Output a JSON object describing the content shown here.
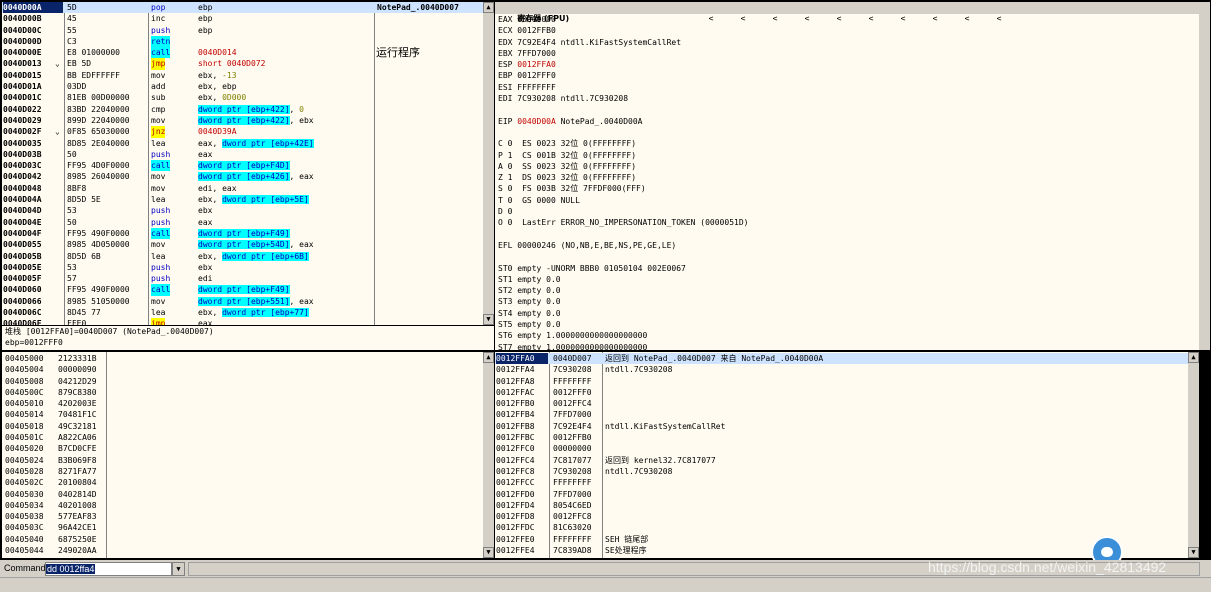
{
  "disasm": {
    "comment_label": "运行程序",
    "header_comment": "NotePad_.0040D007",
    "rows": [
      {
        "addr": "0040D00A",
        "mark": "",
        "hex": "5D",
        "mnem": "pop",
        "ops": "ebp",
        "sel": true,
        "mc": "blue"
      },
      {
        "addr": "0040D00B",
        "mark": "",
        "hex": "45",
        "mnem": "inc",
        "ops": "ebp"
      },
      {
        "addr": "0040D00C",
        "mark": "",
        "hex": "55",
        "mnem": "push",
        "ops": "ebp",
        "mc": "blue"
      },
      {
        "addr": "0040D00D",
        "mark": "",
        "hex": "C3",
        "mnem": "retn",
        "ops": "",
        "mhl": "cyan"
      },
      {
        "addr": "0040D00E",
        "mark": "",
        "hex": "E8 01000000",
        "mnem": "call",
        "ops": "0040D014",
        "mhl": "cyan",
        "oc": "red"
      },
      {
        "addr": "0040D013",
        "mark": "⌄",
        "hex": "EB 5D",
        "mnem": "jmp",
        "ops": "short 0040D072",
        "mhl": "yellow",
        "oc": "red"
      },
      {
        "addr": "0040D015",
        "mark": "",
        "hex": "BB EDFFFFFF",
        "mnem": "mov",
        "ops": "ebx, -13"
      },
      {
        "addr": "0040D01A",
        "mark": "",
        "hex": "03DD",
        "mnem": "add",
        "ops": "ebx, ebp"
      },
      {
        "addr": "0040D01C",
        "mark": "",
        "hex": "81EB 00D00000",
        "mnem": "sub",
        "ops": "ebx, 0D000"
      },
      {
        "addr": "0040D022",
        "mark": "",
        "hex": "83BD 22040000",
        "mnem": "cmp",
        "ops": "dword ptr [ebp+422], 0",
        "ohl": true
      },
      {
        "addr": "0040D029",
        "mark": "",
        "hex": "899D 22040000",
        "mnem": "mov",
        "ops": "dword ptr [ebp+422], ebx",
        "ohl": true
      },
      {
        "addr": "0040D02F",
        "mark": "⌄",
        "hex": "0F85 65030000",
        "mnem": "jnz",
        "ops": "0040D39A",
        "mhl": "yellow",
        "oc": "red"
      },
      {
        "addr": "0040D035",
        "mark": "",
        "hex": "8D85 2E040000",
        "mnem": "lea",
        "ops": "eax, dword ptr [ebp+42E]",
        "ohl": true
      },
      {
        "addr": "0040D03B",
        "mark": "",
        "hex": "50",
        "mnem": "push",
        "ops": "eax",
        "mc": "blue"
      },
      {
        "addr": "0040D03C",
        "mark": "",
        "hex": "FF95 4D0F0000",
        "mnem": "call",
        "ops": "dword ptr [ebp+F4D]",
        "mhl": "cyan",
        "ohl": true
      },
      {
        "addr": "0040D042",
        "mark": "",
        "hex": "8985 26040000",
        "mnem": "mov",
        "ops": "dword ptr [ebp+426], eax",
        "ohl": true
      },
      {
        "addr": "0040D048",
        "mark": "",
        "hex": "8BF8",
        "mnem": "mov",
        "ops": "edi, eax"
      },
      {
        "addr": "0040D04A",
        "mark": "",
        "hex": "8D5D 5E",
        "mnem": "lea",
        "ops": "ebx, dword ptr [ebp+5E]",
        "ohl": true
      },
      {
        "addr": "0040D04D",
        "mark": "",
        "hex": "53",
        "mnem": "push",
        "ops": "ebx",
        "mc": "blue"
      },
      {
        "addr": "0040D04E",
        "mark": "",
        "hex": "50",
        "mnem": "push",
        "ops": "eax",
        "mc": "blue"
      },
      {
        "addr": "0040D04F",
        "mark": "",
        "hex": "FF95 490F0000",
        "mnem": "call",
        "ops": "dword ptr [ebp+F49]",
        "mhl": "cyan",
        "ohl": true
      },
      {
        "addr": "0040D055",
        "mark": "",
        "hex": "8985 4D050000",
        "mnem": "mov",
        "ops": "dword ptr [ebp+54D], eax",
        "ohl": true
      },
      {
        "addr": "0040D05B",
        "mark": "",
        "hex": "8D5D 6B",
        "mnem": "lea",
        "ops": "ebx, dword ptr [ebp+6B]",
        "ohl": true
      },
      {
        "addr": "0040D05E",
        "mark": "",
        "hex": "53",
        "mnem": "push",
        "ops": "ebx",
        "mc": "blue"
      },
      {
        "addr": "0040D05F",
        "mark": "",
        "hex": "57",
        "mnem": "push",
        "ops": "edi",
        "mc": "blue"
      },
      {
        "addr": "0040D060",
        "mark": "",
        "hex": "FF95 490F0000",
        "mnem": "call",
        "ops": "dword ptr [ebp+F49]",
        "mhl": "cyan",
        "ohl": true
      },
      {
        "addr": "0040D066",
        "mark": "",
        "hex": "8985 51050000",
        "mnem": "mov",
        "ops": "dword ptr [ebp+551], eax",
        "ohl": true
      },
      {
        "addr": "0040D06C",
        "mark": "",
        "hex": "8D45 77",
        "mnem": "lea",
        "ops": "ebx, dword ptr [ebp+77]",
        "ohl": true
      },
      {
        "addr": "0040D06F",
        "mark": "",
        "hex": "FFE0",
        "mnem": "jmp",
        "ops": "eax",
        "mhl": "yellow"
      }
    ]
  },
  "info": {
    "line1": "堆栈 [0012FFA0]=0040D007 (NotePad_.0040D007)",
    "line2": "ebp=0012FFF0"
  },
  "registers": {
    "title": "寄存器 (FPU)",
    "nav": [
      "<",
      "<",
      "<",
      "<",
      "<",
      "<",
      "<",
      "<",
      "<",
      "<"
    ],
    "gp": [
      {
        "name": "EAX",
        "val": "00000000",
        "note": "",
        "red": false
      },
      {
        "name": "ECX",
        "val": "0012FFB0",
        "note": "",
        "red": false
      },
      {
        "name": "EDX",
        "val": "7C92E4F4",
        "note": "ntdll.KiFastSystemCallRet",
        "red": false
      },
      {
        "name": "EBX",
        "val": "7FFD7000",
        "note": "",
        "red": false
      },
      {
        "name": "ESP",
        "val": "0012FFA0",
        "note": "",
        "red": true
      },
      {
        "name": "EBP",
        "val": "0012FFF0",
        "note": "",
        "red": false
      },
      {
        "name": "ESI",
        "val": "FFFFFFFF",
        "note": "",
        "red": false
      },
      {
        "name": "EDI",
        "val": "7C930208",
        "note": "ntdll.7C930208",
        "red": false
      }
    ],
    "eip": {
      "name": "EIP",
      "val": "0040D00A",
      "note": "NotePad_.0040D00A"
    },
    "flags": [
      "C 0  ES 0023 32位 0(FFFFFFFF)",
      "P 1  CS 001B 32位 0(FFFFFFFF)",
      "A 0  SS 0023 32位 0(FFFFFFFF)",
      "Z 1  DS 0023 32位 0(FFFFFFFF)",
      "S 0  FS 003B 32位 7FFDF000(FFF)",
      "T 0  GS 0000 NULL",
      "D 0",
      "O 0  LastErr ERROR_NO_IMPERSONATION_TOKEN (0000051D)"
    ],
    "efl": "EFL 00000246 (NO,NB,E,BE,NS,PE,GE,LE)",
    "fpu": [
      "ST0 empty -UNORM BBB0 01050104 002E0067",
      "ST1 empty 0.0",
      "ST2 empty 0.0",
      "ST3 empty 0.0",
      "ST4 empty 0.0",
      "ST5 empty 0.0",
      "ST6 empty 1.0000000000000000000",
      "ST7 empty 1.0000000000000000000"
    ],
    "fpu_hdr": "               3 2 1 0      E S P U O Z D I",
    "fst": "FST 4020  Cond 1 0 0 0  Err 0 0 1 0 0 0 0 0  (EQ)"
  },
  "dump": {
    "rows": [
      {
        "addr": "00405000",
        "val": "2123331B"
      },
      {
        "addr": "00405004",
        "val": "00000090"
      },
      {
        "addr": "00405008",
        "val": "04212D29"
      },
      {
        "addr": "0040500C",
        "val": "879C8380"
      },
      {
        "addr": "00405010",
        "val": "4202003E"
      },
      {
        "addr": "00405014",
        "val": "70481F1C"
      },
      {
        "addr": "00405018",
        "val": "49C32181"
      },
      {
        "addr": "0040501C",
        "val": "A822CA06"
      },
      {
        "addr": "00405020",
        "val": "B7CD0CFE"
      },
      {
        "addr": "00405024",
        "val": "B3B069F8"
      },
      {
        "addr": "00405028",
        "val": "8271FA77"
      },
      {
        "addr": "0040502C",
        "val": "20100804"
      },
      {
        "addr": "00405030",
        "val": "0402814D"
      },
      {
        "addr": "00405034",
        "val": "40201008"
      },
      {
        "addr": "00405038",
        "val": "577EAF83"
      },
      {
        "addr": "0040503C",
        "val": "96A42CE1"
      },
      {
        "addr": "00405040",
        "val": "6875250E"
      },
      {
        "addr": "00405044",
        "val": "249020AA"
      }
    ]
  },
  "stack": {
    "rows": [
      {
        "addr": "0012FFA0",
        "val": "0040D007",
        "note": "返回到 NotePad_.0040D007 来自 NotePad_.0040D00A",
        "sel": true
      },
      {
        "addr": "0012FFA4",
        "val": "7C930208",
        "note": "ntdll.7C930208"
      },
      {
        "addr": "0012FFA8",
        "val": "FFFFFFFF",
        "note": ""
      },
      {
        "addr": "0012FFAC",
        "val": "0012FFF0",
        "note": ""
      },
      {
        "addr": "0012FFB0",
        "val": "0012FFC4",
        "note": ""
      },
      {
        "addr": "0012FFB4",
        "val": "7FFD7000",
        "note": ""
      },
      {
        "addr": "0012FFB8",
        "val": "7C92E4F4",
        "note": "ntdll.KiFastSystemCallRet"
      },
      {
        "addr": "0012FFBC",
        "val": "0012FFB0",
        "note": ""
      },
      {
        "addr": "0012FFC0",
        "val": "00000000",
        "note": ""
      },
      {
        "addr": "0012FFC4",
        "val": "7C817077",
        "note": "返回到 kernel32.7C817077"
      },
      {
        "addr": "0012FFC8",
        "val": "7C930208",
        "note": "ntdll.7C930208"
      },
      {
        "addr": "0012FFCC",
        "val": "FFFFFFFF",
        "note": ""
      },
      {
        "addr": "0012FFD0",
        "val": "7FFD7000",
        "note": ""
      },
      {
        "addr": "0012FFD4",
        "val": "8054C6ED",
        "note": ""
      },
      {
        "addr": "0012FFD8",
        "val": "0012FFC8",
        "note": ""
      },
      {
        "addr": "0012FFDC",
        "val": "81C63020",
        "note": ""
      },
      {
        "addr": "0012FFE0",
        "val": "FFFFFFFF",
        "note": "SEH 链尾部"
      },
      {
        "addr": "0012FFE4",
        "val": "7C839AD8",
        "note": "SE处理程序"
      }
    ]
  },
  "command": {
    "label": "Command",
    "value": "dd 0012ffa4",
    "dropdown": "▼"
  },
  "watermark": "https://blog.csdn.net/weixin_42813492"
}
